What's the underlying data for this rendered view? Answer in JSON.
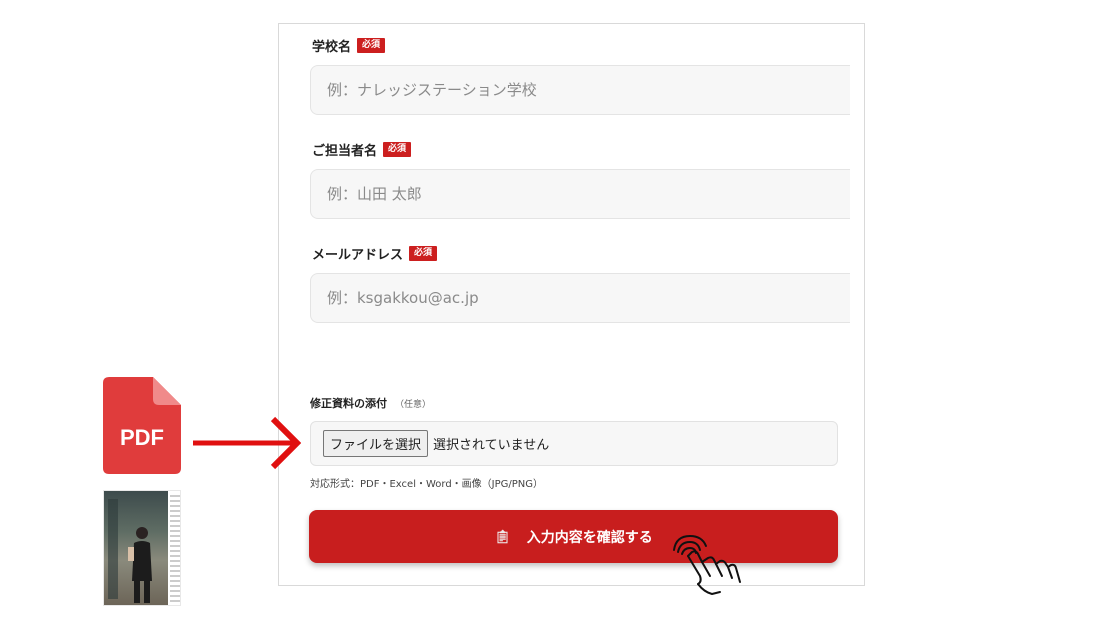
{
  "form": {
    "school_name": {
      "label": "学校名",
      "required_badge": "必須",
      "placeholder": "例：ナレッジステーション学校"
    },
    "contact_name": {
      "label": "ご担当者名",
      "required_badge": "必須",
      "placeholder": "例：山田 太郎"
    },
    "email": {
      "label": "メールアドレス",
      "required_badge": "必須",
      "placeholder": "例：ksgakkou@ac.jp"
    },
    "attachment": {
      "label": "修正資料の添付",
      "optional_note": "（任意）",
      "choose_button": "ファイルを選択",
      "status": "選択されていません",
      "formats_note": "対応形式：PDF・Excel・Word・画像（JPG/PNG）"
    },
    "submit": {
      "label": "入力内容を確認する",
      "icon": "clipboard-icon"
    }
  },
  "illustration": {
    "pdf_icon_label": "PDF",
    "pdf_icon_color": "#e03c3c",
    "arrow_color": "#e01010",
    "accent_color": "#c81e1e"
  }
}
